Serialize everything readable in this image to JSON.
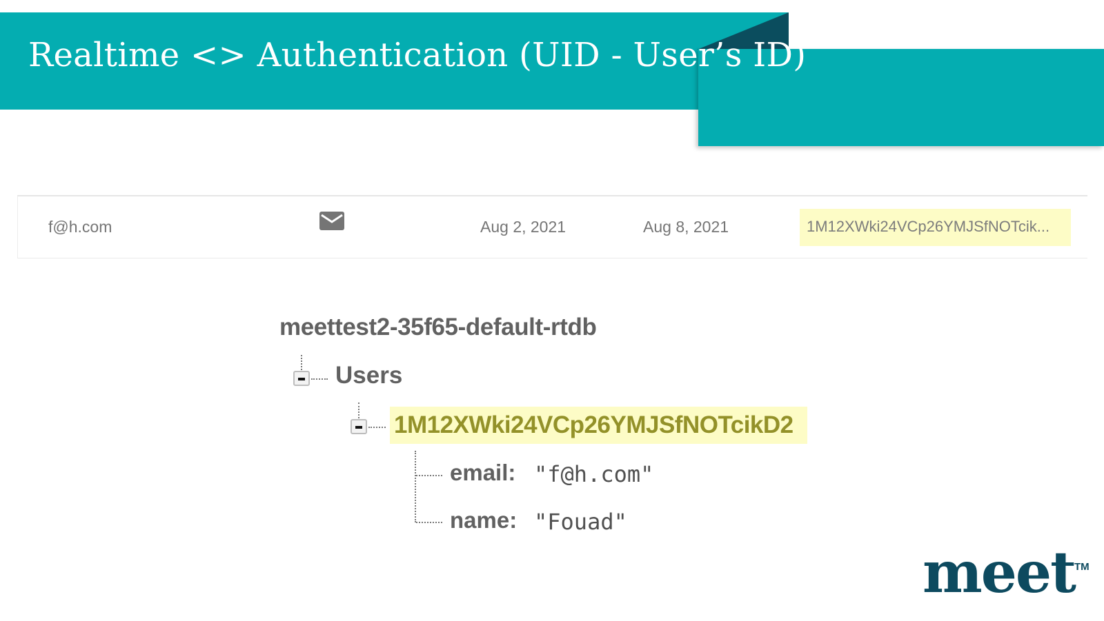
{
  "slide": {
    "title": "Realtime <>  Authentication (UID - User’s ID)",
    "colors": {
      "banner": "#04adb1",
      "banner_fold": "#0b4d5e",
      "highlight": "#fdfcc6",
      "logo": "#0d4a5f"
    }
  },
  "auth_user": {
    "email": "f@h.com",
    "provider_icon": "mail-icon",
    "created": "Aug 2, 2021",
    "signed_in": "Aug 8, 2021",
    "uid": "1M12XWki24VCp26YMJSfNOTcik..."
  },
  "database": {
    "name": "meettest2-35f65-default-rtdb",
    "users_key": "Users",
    "uid_key": "1M12XWki24VCp26YMJSfNOTcikD2",
    "fields": [
      {
        "key": "email:",
        "value": "\"f@h.com\""
      },
      {
        "key": "name:",
        "value": "\"Fouad\""
      }
    ]
  },
  "logo": {
    "text": "meet",
    "tm": "TM"
  }
}
